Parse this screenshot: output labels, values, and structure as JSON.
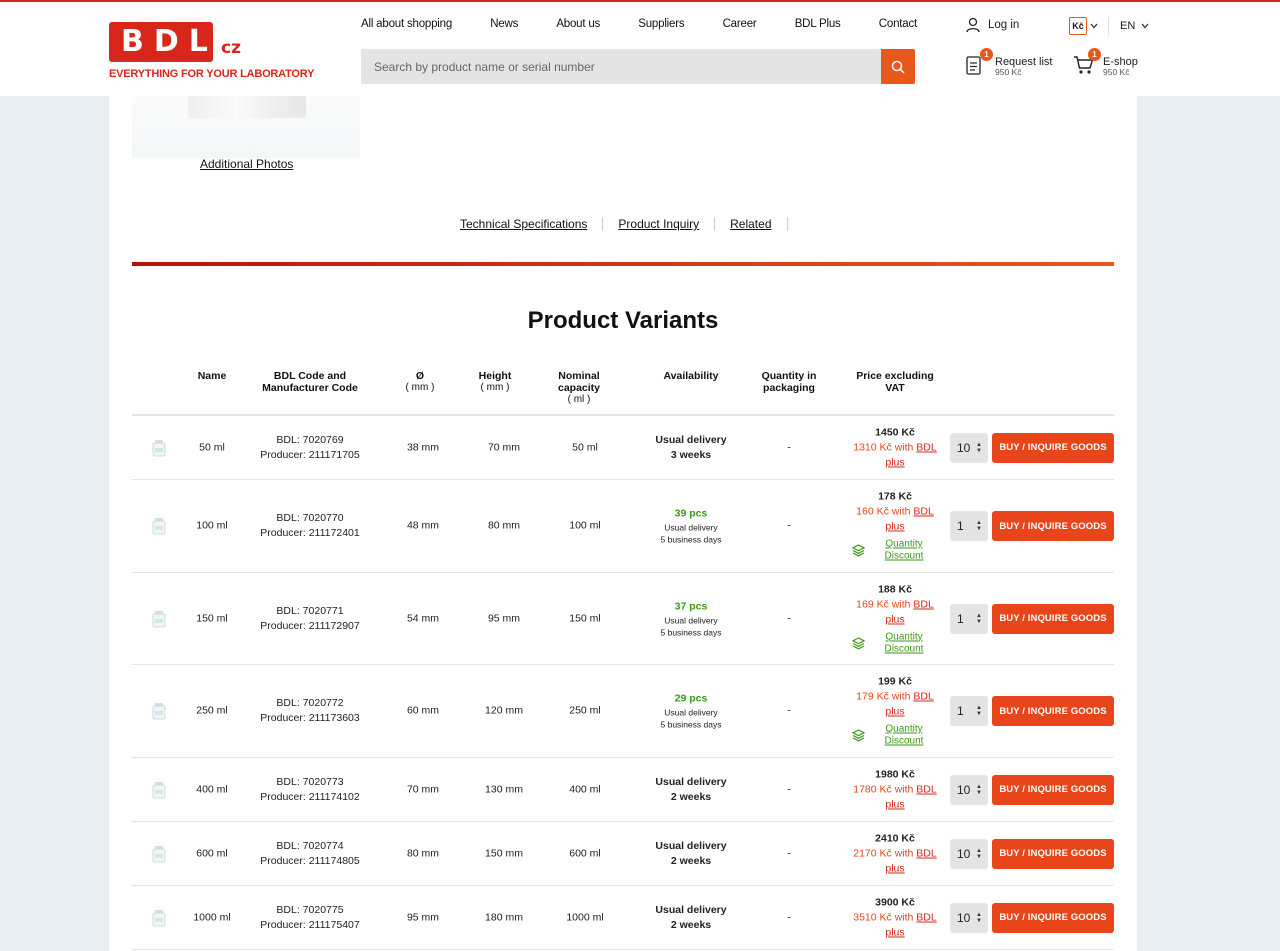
{
  "header": {
    "logo_text": "BDL",
    "logo_suffix": "cz",
    "logo_tagline": "EVERYTHING FOR YOUR LABORATORY",
    "nav": [
      "All about shopping",
      "News",
      "About us",
      "Suppliers",
      "Career",
      "BDL Plus",
      "Contact"
    ],
    "search_placeholder": "Search by product name or serial number",
    "login_label": "Log in",
    "currency": "Kč",
    "language": "EN",
    "request_list": {
      "label": "Request list",
      "sub": "950 Kč",
      "count": "1"
    },
    "eshop": {
      "label": "E-shop",
      "sub": "950 Kč",
      "count": "1"
    }
  },
  "product": {
    "additional_photos": "Additional Photos",
    "tabs": [
      "Technical Specifications",
      "Product Inquiry",
      "Related"
    ]
  },
  "variants": {
    "title": "Product Variants",
    "columns": {
      "name": "Name",
      "code": "BDL Code and Manufacturer Code",
      "diameter": "Ø",
      "diameter_unit": "( mm )",
      "height": "Height",
      "height_unit": "( mm )",
      "capacity": "Nominal capacity",
      "capacity_unit": "( ml )",
      "availability": "Availability",
      "qty_packaging": "Quantity in packaging",
      "price": "Price excluding VAT"
    },
    "buy_label": "BUY / INQUIRE GOODS",
    "qd_label": "Quantity Discount",
    "rows": [
      {
        "name": "50 ml",
        "bdl": "BDL: 7020769",
        "producer": "Producer: 211171705",
        "diameter": "38 mm",
        "height": "70 mm",
        "capacity": "50 ml",
        "avail_main": "Usual delivery",
        "avail_sub": "3 weeks",
        "stock": "",
        "pack": "-",
        "price": "1450 Kč",
        "price_plus": "1310 Kč with",
        "plus_a": "BDL",
        "plus_b": "plus",
        "qty": "10",
        "discount": false
      },
      {
        "name": "100 ml",
        "bdl": "BDL: 7020770",
        "producer": "Producer: 211172401",
        "diameter": "48 mm",
        "height": "80 mm",
        "capacity": "100 ml",
        "avail_main": "Usual delivery",
        "avail_sub": "5 business days",
        "stock": "39 pcs",
        "pack": "-",
        "price": "178 Kč",
        "price_plus": "160 Kč with",
        "plus_a": "BDL",
        "plus_b": "plus",
        "qty": "1",
        "discount": true
      },
      {
        "name": "150 ml",
        "bdl": "BDL: 7020771",
        "producer": "Producer: 211172907",
        "diameter": "54 mm",
        "height": "95 mm",
        "capacity": "150 ml",
        "avail_main": "Usual delivery",
        "avail_sub": "5 business days",
        "stock": "37 pcs",
        "pack": "-",
        "price": "188 Kč",
        "price_plus": "169 Kč with",
        "plus_a": "BDL",
        "plus_b": "plus",
        "qty": "1",
        "discount": true
      },
      {
        "name": "250 ml",
        "bdl": "BDL: 7020772",
        "producer": "Producer: 211173603",
        "diameter": "60 mm",
        "height": "120 mm",
        "capacity": "250 ml",
        "avail_main": "Usual delivery",
        "avail_sub": "5 business days",
        "stock": "29 pcs",
        "pack": "-",
        "price": "199 Kč",
        "price_plus": "179 Kč with",
        "plus_a": "BDL",
        "plus_b": "plus",
        "qty": "1",
        "discount": true
      },
      {
        "name": "400 ml",
        "bdl": "BDL: 7020773",
        "producer": "Producer: 211174102",
        "diameter": "70 mm",
        "height": "130 mm",
        "capacity": "400 ml",
        "avail_main": "Usual delivery",
        "avail_sub": "2 weeks",
        "stock": "",
        "pack": "-",
        "price": "1980 Kč",
        "price_plus": "1780 Kč with",
        "plus_a": "BDL",
        "plus_b": "plus",
        "qty": "10",
        "discount": false
      },
      {
        "name": "600 ml",
        "bdl": "BDL: 7020774",
        "producer": "Producer: 211174805",
        "diameter": "80 mm",
        "height": "150 mm",
        "capacity": "600 ml",
        "avail_main": "Usual delivery",
        "avail_sub": "2 weeks",
        "stock": "",
        "pack": "-",
        "price": "2410 Kč",
        "price_plus": "2170 Kč with",
        "plus_a": "BDL",
        "plus_b": "plus",
        "qty": "10",
        "discount": false
      },
      {
        "name": "1000 ml",
        "bdl": "BDL: 7020775",
        "producer": "Producer: 211175407",
        "diameter": "95 mm",
        "height": "180 mm",
        "capacity": "1000 ml",
        "avail_main": "Usual delivery",
        "avail_sub": "2 weeks",
        "stock": "",
        "pack": "-",
        "price": "3900 Kč",
        "price_plus": "3510 Kč with",
        "plus_a": "BDL",
        "plus_b": "plus",
        "qty": "10",
        "discount": false
      }
    ]
  }
}
